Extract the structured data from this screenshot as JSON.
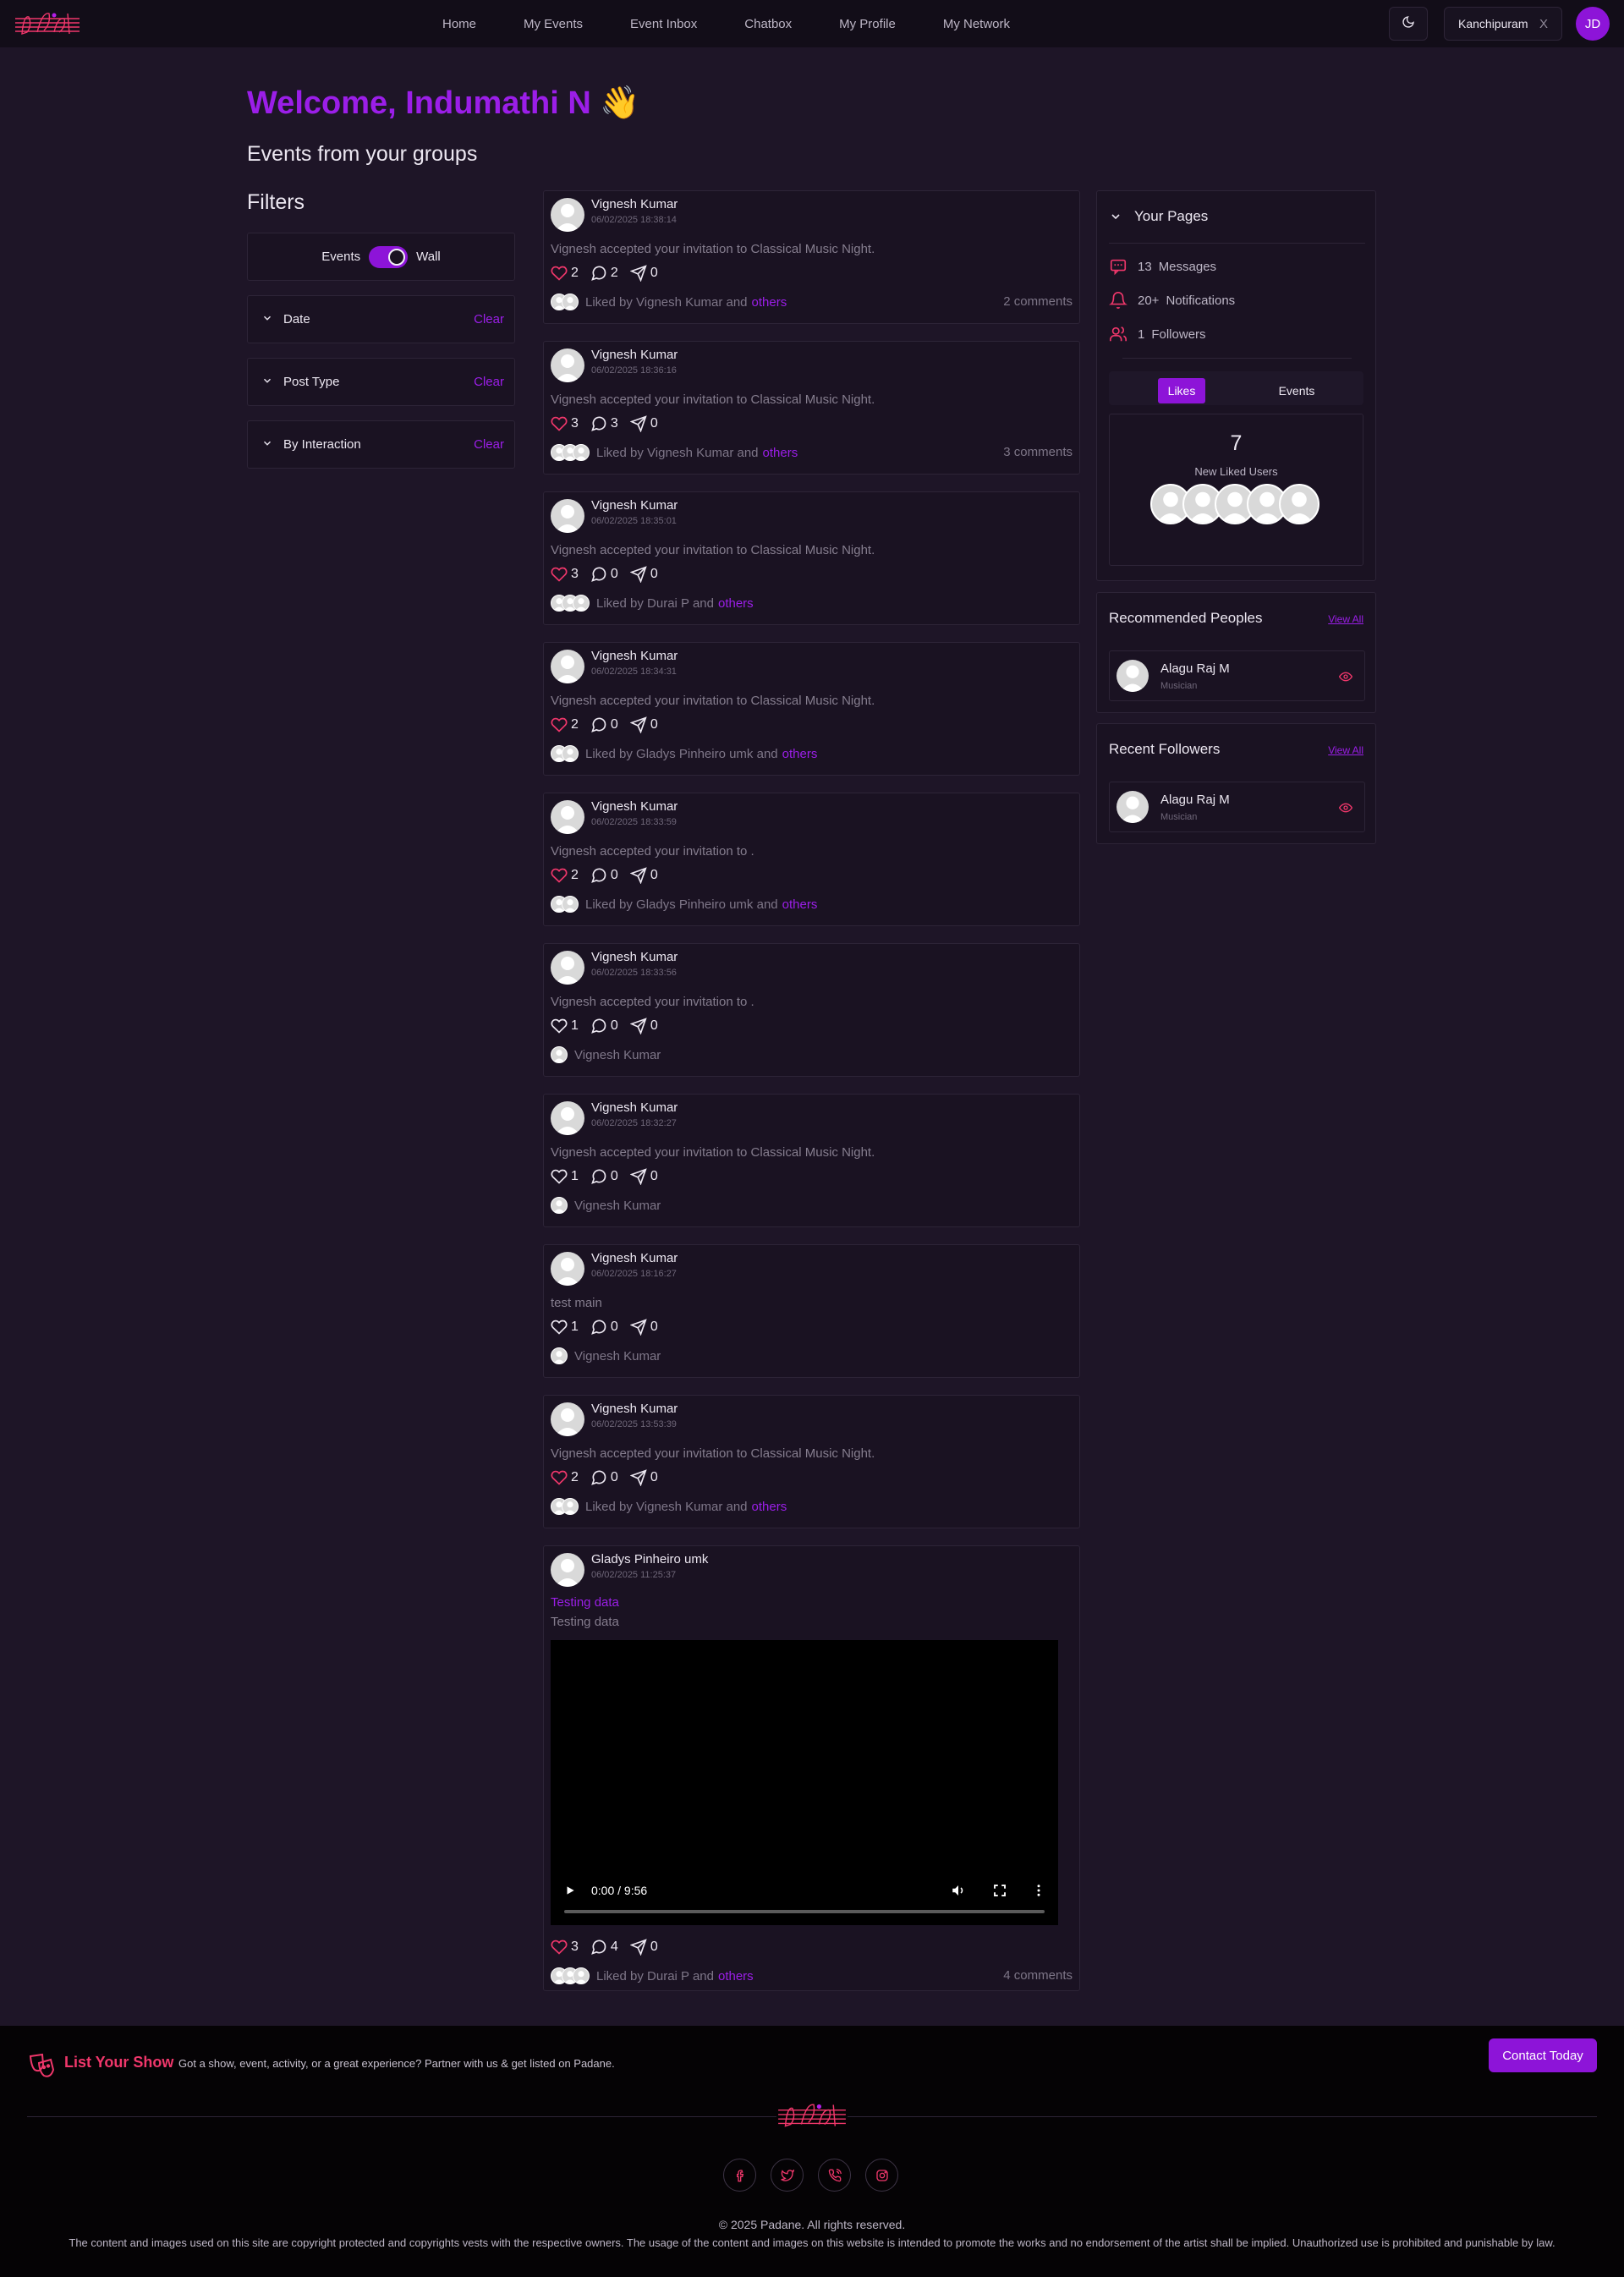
{
  "nav": {
    "links": [
      "Home",
      "My Events",
      "Event Inbox",
      "Chatbox",
      "My Profile",
      "My Network"
    ],
    "location": "Kanchipuram",
    "location_clear": "X",
    "avatar_initials": "JD"
  },
  "welcome": "Welcome, Indumathi N 👋",
  "subtitle": "Events from your groups",
  "filters": {
    "title": "Filters",
    "toggle_left": "Events",
    "toggle_right": "Wall",
    "toggle_on": true,
    "rows": [
      {
        "label": "Date",
        "clear": "Clear"
      },
      {
        "label": "Post Type",
        "clear": "Clear"
      },
      {
        "label": "By Interaction",
        "clear": "Clear"
      }
    ]
  },
  "posts": [
    {
      "author": "Vignesh Kumar",
      "time": "06/02/2025 18:38:14",
      "text": "Vignesh accepted your invitation to Classical Music Night.",
      "likes": "2",
      "comments": "2",
      "shares": "0",
      "liked_by": "Liked by Vignesh Kumar and",
      "others": "others",
      "comments_label": "2 comments"
    },
    {
      "author": "Vignesh Kumar",
      "time": "06/02/2025 18:36:16",
      "text": "Vignesh accepted your invitation to Classical Music Night.",
      "likes": "3",
      "comments": "3",
      "shares": "0",
      "liked_by": "Liked by Vignesh Kumar and",
      "others": "others",
      "comments_label": "3 comments"
    },
    {
      "author": "Vignesh Kumar",
      "time": "06/02/2025 18:35:01",
      "text": "Vignesh accepted your invitation to Classical Music Night.",
      "likes": "3",
      "comments": "0",
      "shares": "0",
      "liked_by": "Liked by Durai P and",
      "others": "others",
      "comments_label": ""
    },
    {
      "author": "Vignesh Kumar",
      "time": "06/02/2025 18:34:31",
      "text": "Vignesh accepted your invitation to Classical Music Night.",
      "likes": "2",
      "comments": "0",
      "shares": "0",
      "liked_by": "Liked by Gladys Pinheiro umk and",
      "others": "others",
      "comments_label": ""
    },
    {
      "author": "Vignesh Kumar",
      "time": "06/02/2025 18:33:59",
      "text": "Vignesh accepted your invitation to .",
      "likes": "2",
      "comments": "0",
      "shares": "0",
      "liked_by": "Liked by Gladys Pinheiro umk and",
      "others": "others",
      "comments_label": ""
    },
    {
      "author": "Vignesh Kumar",
      "time": "06/02/2025 18:33:56",
      "text": "Vignesh accepted your invitation to .",
      "likes": "1",
      "comments": "0",
      "shares": "0",
      "liked_by": "Vignesh Kumar",
      "others": "",
      "comments_label": ""
    },
    {
      "author": "Vignesh Kumar",
      "time": "06/02/2025 18:32:27",
      "text": "Vignesh accepted your invitation to Classical Music Night.",
      "likes": "1",
      "comments": "0",
      "shares": "0",
      "liked_by": "Vignesh Kumar",
      "others": "",
      "comments_label": ""
    },
    {
      "author": "Vignesh Kumar",
      "time": "06/02/2025 18:16:27",
      "text": "test main",
      "likes": "1",
      "comments": "0",
      "shares": "0",
      "liked_by": "Vignesh Kumar",
      "others": "",
      "comments_label": ""
    },
    {
      "author": "Vignesh Kumar",
      "time": "06/02/2025 13:53:39",
      "text": "Vignesh accepted your invitation to Classical Music Night.",
      "likes": "2",
      "comments": "0",
      "shares": "0",
      "liked_by": "Liked by Vignesh Kumar and",
      "others": "others",
      "comments_label": ""
    },
    {
      "author": "Gladys Pinheiro umk",
      "time": "06/02/2025 11:25:37",
      "title": "Testing data",
      "text": "Testing data",
      "video_time": "0:00 / 9:56",
      "likes": "3",
      "comments": "4",
      "shares": "0",
      "liked_by": "Liked by Durai P and",
      "others": "others",
      "comments_label": "4 comments"
    }
  ],
  "right": {
    "pages_title": "Your Pages",
    "messages_count": "13",
    "messages_label": "Messages",
    "notifications_count": "20+",
    "notifications_label": "Notifications",
    "followers_count": "1",
    "followers_label": "Followers",
    "tab_likes": "Likes",
    "tab_events": "Events",
    "liked_count": "7",
    "liked_label": "New Liked Users",
    "recommended_title": "Recommended Peoples",
    "recent_title": "Recent Followers",
    "view_all": "View All",
    "recommended": {
      "name": "Alagu Raj M",
      "role": "Musician"
    },
    "recent": {
      "name": "Alagu Raj M",
      "role": "Musician"
    }
  },
  "footer": {
    "list_title": "List Your Show",
    "list_text": "Got a show, event, activity, or a great experience? Partner with us & get listed on Padane.",
    "contact": "Contact Today",
    "copyright": "© 2025 Padane. All rights reserved.",
    "disclaimer": "The content and images used on this site are copyright protected and copyrights vests with the respective owners. The usage of the content and images on this website is intended to promote the works and no endorsement of the artist shall be implied. Unauthorized use is prohibited and punishable by law."
  },
  "colors": {
    "accent": "#8d14d8",
    "brand_pink": "#f0376b",
    "background": "#1e1527",
    "card": "#1a1222"
  }
}
